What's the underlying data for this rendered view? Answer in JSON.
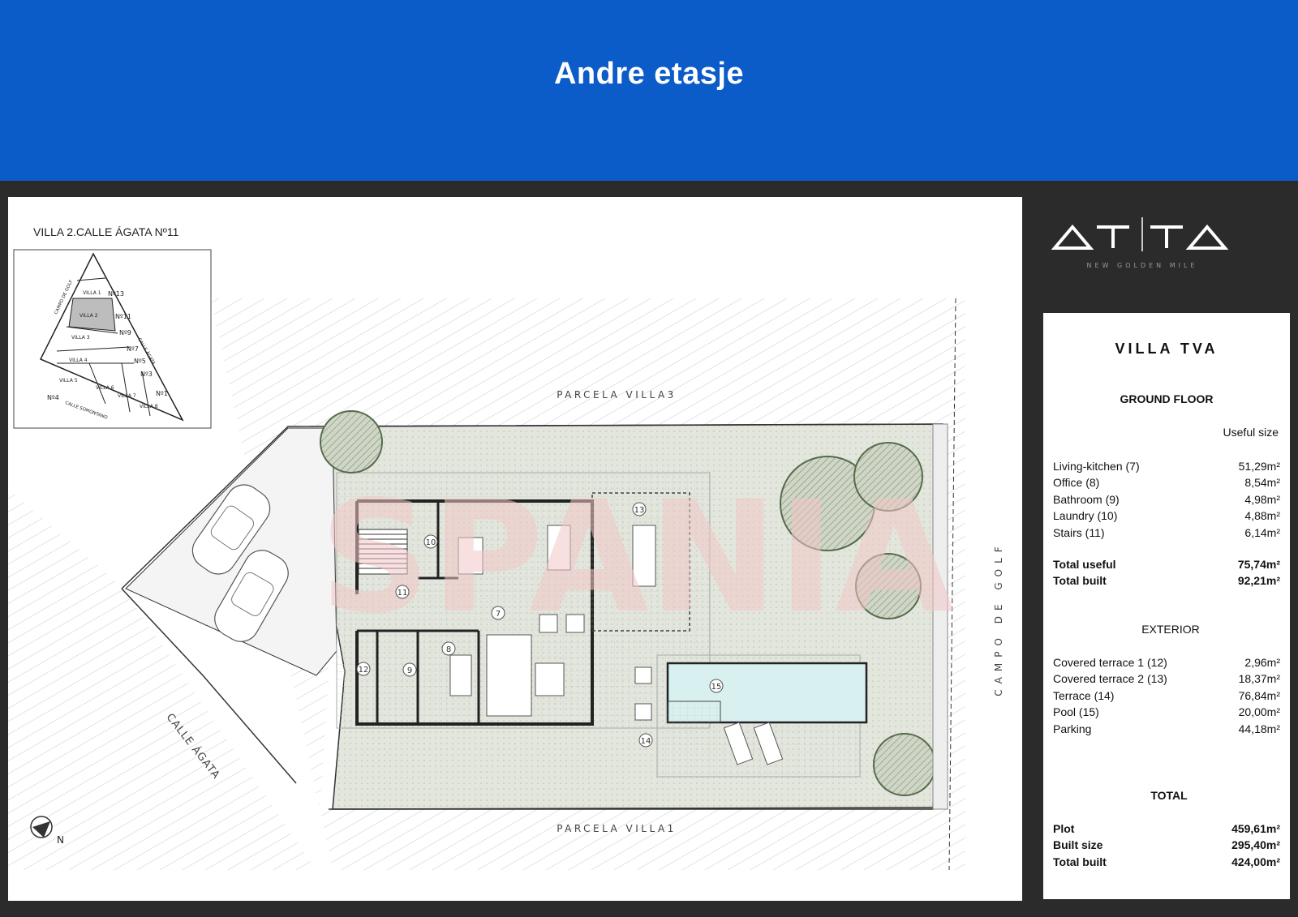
{
  "header": {
    "title": "Andre etasje"
  },
  "plan": {
    "villa_label": "VILLA 2.CALLE ÁGATA Nº11",
    "inset_labels": {
      "villas": [
        "VILLA 1",
        "VILLA 2",
        "VILLA 3",
        "VILLA 4",
        "VILLA 5",
        "VILLA 6",
        "VILLA 7",
        "VILLA 8"
      ],
      "numbers": [
        "Nº13",
        "Nº11",
        "Nº9",
        "Nº7",
        "Nº5",
        "Nº3",
        "Nº1",
        "Nº4"
      ],
      "campo": "CAMPO DE GOLF",
      "calle_agata": "CALLE ÁGATA",
      "calle_somontano": "CALLE SOMONTANO"
    },
    "parcela_top": "PARCELA VILLA3",
    "parcela_bottom": "PARCELA VILLA1",
    "campo_de_golf": "CAMPO DE GOLF",
    "calle_agata": "CALLE ÁGATA",
    "north": "N",
    "watermark": "SPANIA",
    "room_numbers": [
      "7",
      "8",
      "9",
      "10",
      "11",
      "12",
      "13",
      "14",
      "15"
    ]
  },
  "logo": {
    "name": "ATTA",
    "tagline": "NEW GOLDEN MILE"
  },
  "card": {
    "title": "VILLA TVA",
    "ground_floor": "GROUND FLOOR",
    "useful_size": "Useful size",
    "rooms": [
      {
        "name": "Living-kitchen (7)",
        "value": "51,29m²"
      },
      {
        "name": "Office (8)",
        "value": "8,54m²"
      },
      {
        "name": "Bathroom (9)",
        "value": "4,98m²"
      },
      {
        "name": "Laundry (10)",
        "value": "4,88m²"
      },
      {
        "name": "Stairs (11)",
        "value": "6,14m²"
      }
    ],
    "totals": [
      {
        "name": "Total useful",
        "value": "75,74m²"
      },
      {
        "name": "Total built",
        "value": "92,21m²"
      }
    ],
    "exterior_title": "EXTERIOR",
    "exterior": [
      {
        "name": "Covered terrace 1 (12)",
        "value": "2,96m²"
      },
      {
        "name": "Covered terrace 2 (13)",
        "value": "18,37m²"
      },
      {
        "name": "Terrace (14)",
        "value": "76,84m²"
      },
      {
        "name": "Pool (15)",
        "value": "20,00m²"
      },
      {
        "name": "Parking",
        "value": "44,18m²"
      }
    ],
    "total_title": "TOTAL",
    "grand": [
      {
        "name": "Plot",
        "value": "459,61m²"
      },
      {
        "name": "Built size",
        "value": "295,40m²"
      },
      {
        "name": "Total built",
        "value": "424,00m²"
      }
    ]
  },
  "colors": {
    "header_bg": "#0b5bc8",
    "frame_bg": "#2b2b2b",
    "garden": "#dfe3d8",
    "pool": "#d8f0f0"
  }
}
